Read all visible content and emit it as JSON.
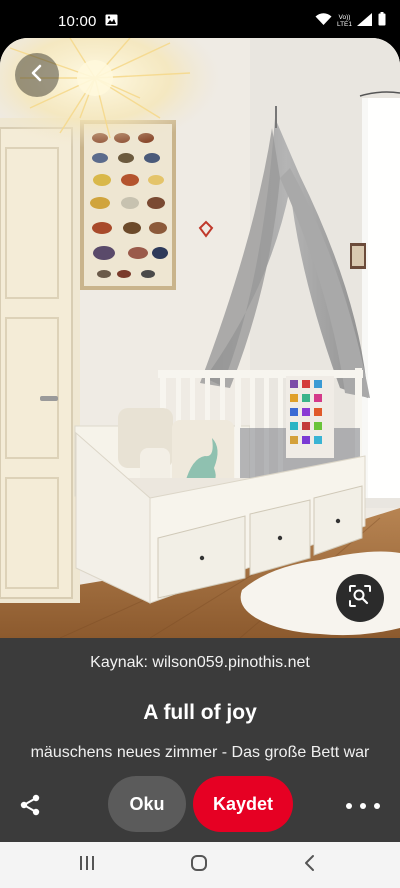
{
  "status_bar": {
    "time": "10:00",
    "network_top": "Vo))",
    "network_bottom": "LTE1",
    "icons": [
      "gallery-icon",
      "wifi-icon",
      "signal-icon",
      "battery-icon"
    ]
  },
  "photo": {
    "description_icon": "lens-search-icon",
    "back_icon": "chevron-left-icon"
  },
  "info": {
    "source_label": "Kaynak: ",
    "source_domain": "wilson059.pinothis.net",
    "title": "A full of joy",
    "description": "mäuschens neues zimmer -  Das große Bett war"
  },
  "actions": {
    "share_icon": "share-icon",
    "read_label": "Oku",
    "save_label": "Kaydet",
    "save_color": "#e60023",
    "more_icon": "more-dots-icon"
  },
  "nav_bar": {
    "icons": [
      "recents-icon",
      "home-icon",
      "back-icon"
    ]
  }
}
